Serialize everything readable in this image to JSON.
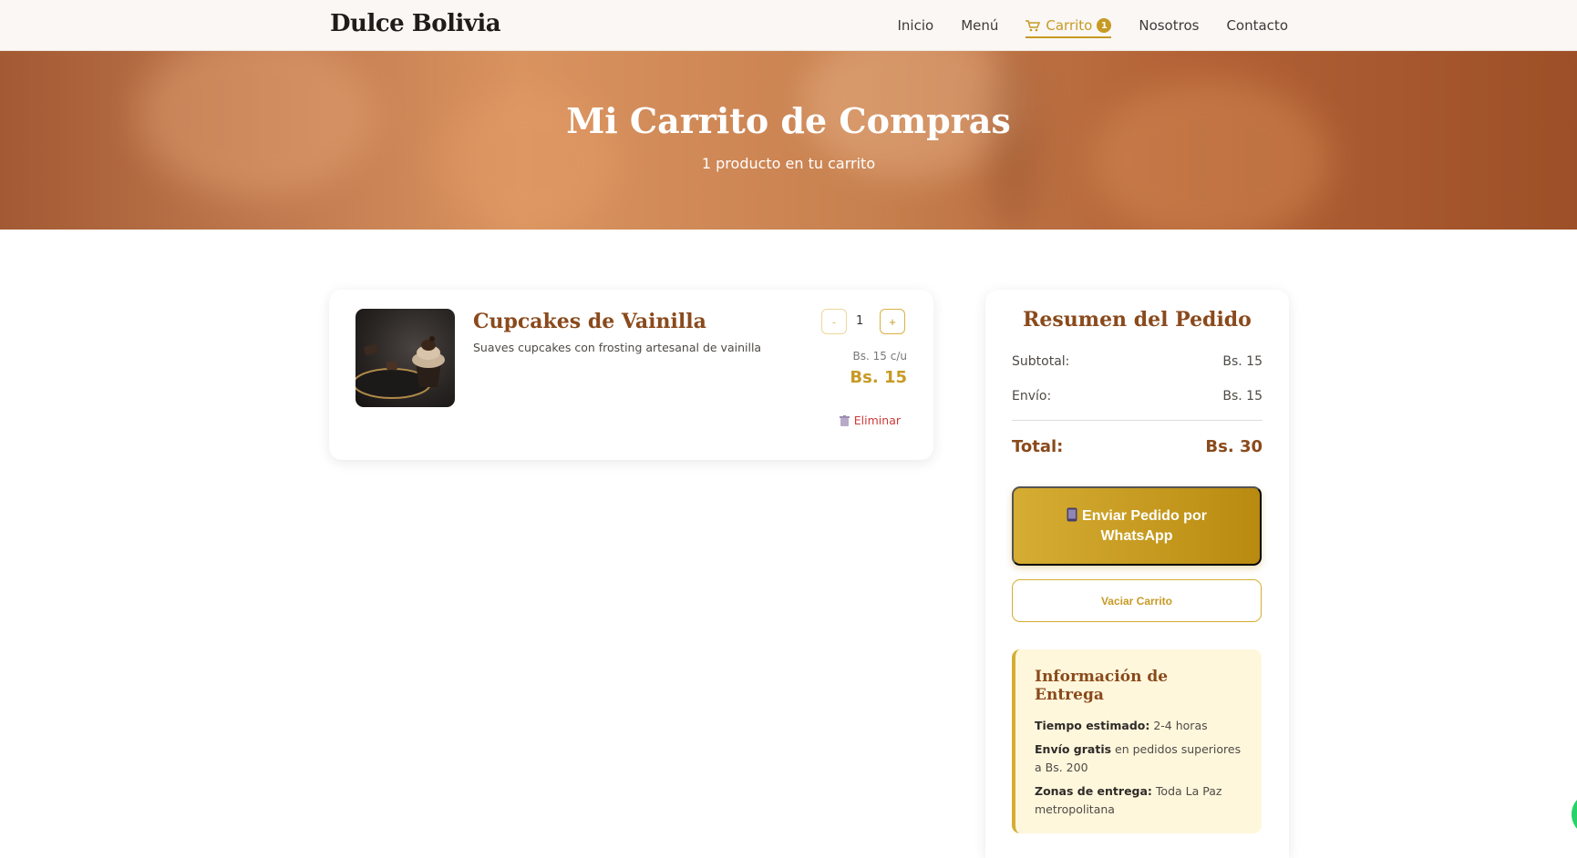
{
  "nav": {
    "brand": "Dulce Bolivia",
    "links": [
      "Inicio",
      "Menú",
      "Carrito",
      "Nosotros",
      "Contacto"
    ],
    "cart_count": "1",
    "active": "Carrito"
  },
  "hero": {
    "title": "Mi Carrito de Compras",
    "subtitle": "1 producto en tu carrito"
  },
  "cart": {
    "items": [
      {
        "name": "Cupcakes de Vainilla",
        "description": "Suaves cupcakes con frosting artesanal de vainilla",
        "minus_label": "-",
        "plus_label": "+",
        "quantity": "1",
        "unit_price": "Bs. 15 c/u",
        "line_total": "Bs. 15",
        "remove_label": "Eliminar",
        "image_icon": "cupcake-photo"
      }
    ]
  },
  "summary": {
    "title": "Resumen del Pedido",
    "subtotal_label": "Subtotal:",
    "subtotal_value": "Bs. 15",
    "shipping_label": "Envío:",
    "shipping_value": "Bs. 15",
    "total_label": "Total:",
    "total_value": "Bs. 30",
    "whatsapp_button": "Enviar Pedido por WhatsApp",
    "clear_button": "Vaciar Carrito"
  },
  "delivery": {
    "title": "Información de Entrega",
    "time_label": "Tiempo estimado:",
    "time_value": " 2-4 horas",
    "free_label": "Envío gratis",
    "free_value": " en pedidos superiores a Bs. 200",
    "zones_label": "Zonas de entrega:",
    "zones_value": " Toda La Paz metropolitana"
  },
  "colors": {
    "accent": "#c79a24",
    "heading_brown": "#8a4a1c",
    "danger": "#d1393a",
    "info_bg": "#fff7dc"
  }
}
